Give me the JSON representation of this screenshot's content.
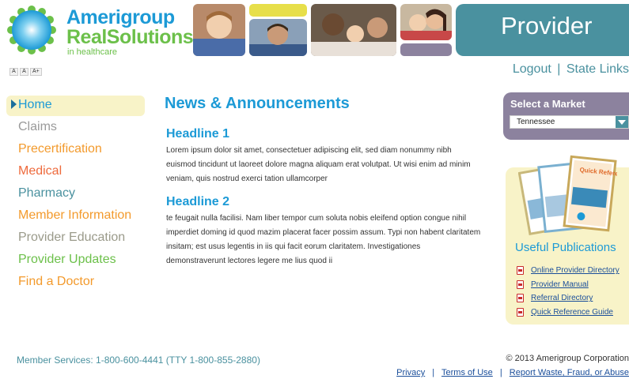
{
  "header": {
    "brand_line1": "Amerigroup",
    "brand_line2": "RealSolutions",
    "brand_line3": "in healthcare",
    "banner_title": "Provider"
  },
  "font_size_buttons": [
    "A",
    "A",
    "A+"
  ],
  "top_links": {
    "logout": "Logout",
    "separator": "|",
    "state_links": "State Links"
  },
  "nav": {
    "items": [
      {
        "label": "Home",
        "color": "#1c9ad6"
      },
      {
        "label": "Claims",
        "color": "#9a9a9a"
      },
      {
        "label": "Precertification",
        "color": "#f39a2c"
      },
      {
        "label": "Medical",
        "color": "#ee6a3c"
      },
      {
        "label": "Pharmacy",
        "color": "#4a919f"
      },
      {
        "label": "Member Information",
        "color": "#f39a2c"
      },
      {
        "label": "Provider Education",
        "color": "#9a9a8a"
      },
      {
        "label": "Provider Updates",
        "color": "#6cc04a"
      },
      {
        "label": "Find a Doctor",
        "color": "#f39a2c"
      }
    ]
  },
  "main": {
    "title": "News & Announcements",
    "articles": [
      {
        "headline": "Headline 1",
        "body": "Lorem ipsum dolor sit amet, consectetuer adipiscing elit, sed diam nonummy nibh euismod tincidunt ut laoreet dolore magna aliquam erat volutpat. Ut wisi enim ad minim veniam, quis nostrud exerci tation ullamcorper"
      },
      {
        "headline": "Headline 2",
        "body": "te feugait nulla facilisi. Nam liber tempor cum soluta nobis eleifend option congue nihil imperdiet doming id quod mazim placerat facer possim assum. Typi non habent claritatem insitam; est usus legentis in iis qui facit eorum claritatem. Investigationes demonstraverunt lectores legere me lius quod ii"
      }
    ]
  },
  "market": {
    "title": "Select a Market",
    "selected": "Tennessee"
  },
  "publications": {
    "title": "Useful Publications",
    "cover_text": "Quick Reference",
    "items": [
      "Online Provider Directory",
      "Provider Manual",
      "Referral Directory",
      "Quick Reference Guide"
    ]
  },
  "footer": {
    "member_services": "Member Services: 1-800-600-4441 (TTY 1-800-855-2880)",
    "copyright": "© 2013 Amerigroup Corporation",
    "links": [
      "Privacy",
      "Terms of Use",
      "Report Waste, Fraud, or Abuse"
    ],
    "separator": "|"
  },
  "colors": {
    "brand_blue": "#1c9ad6",
    "brand_green": "#6cc04a",
    "teal": "#4a919f",
    "purple": "#8c829e",
    "cream": "#f8f3c8"
  }
}
